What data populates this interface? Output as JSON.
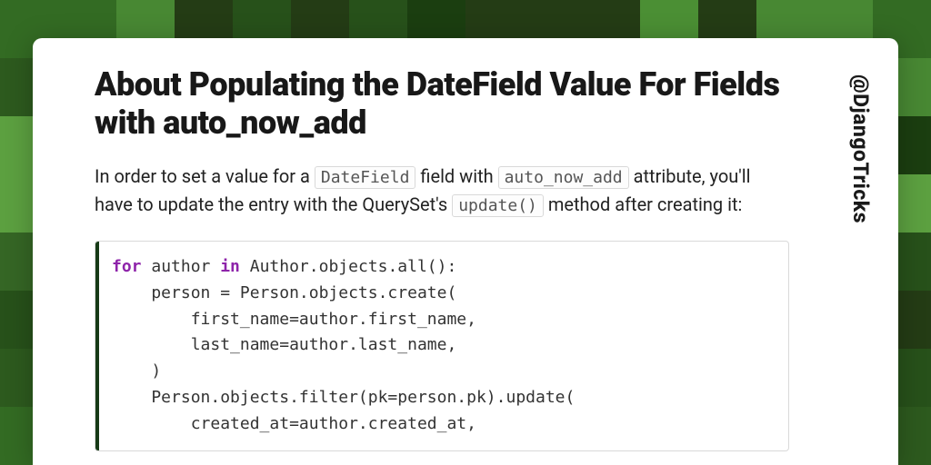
{
  "handle": "@DjangoTricks",
  "title": "About Populating the DateField Value For Fields with auto_now_add",
  "lead": {
    "pre1": "In order to set a value for a ",
    "code1": "DateField",
    "mid1": " field with ",
    "code2": "auto_now_add",
    "mid2": " attribute, you'll have to update the entry with the QuerySet's ",
    "code3": "update()",
    "post": " method after creating it:"
  },
  "code": {
    "kw_for": "for",
    "kw_in": "in",
    "l1a": " author ",
    "l1b": " Author.objects.all():",
    "l2": "    person = Person.objects.create(",
    "l3": "        first_name=author.first_name,",
    "l4": "        last_name=author.last_name,",
    "l5": "    )",
    "l6": "    Person.objects.filter(pk=person.pk).update(",
    "l7": "        created_at=author.created_at,"
  }
}
